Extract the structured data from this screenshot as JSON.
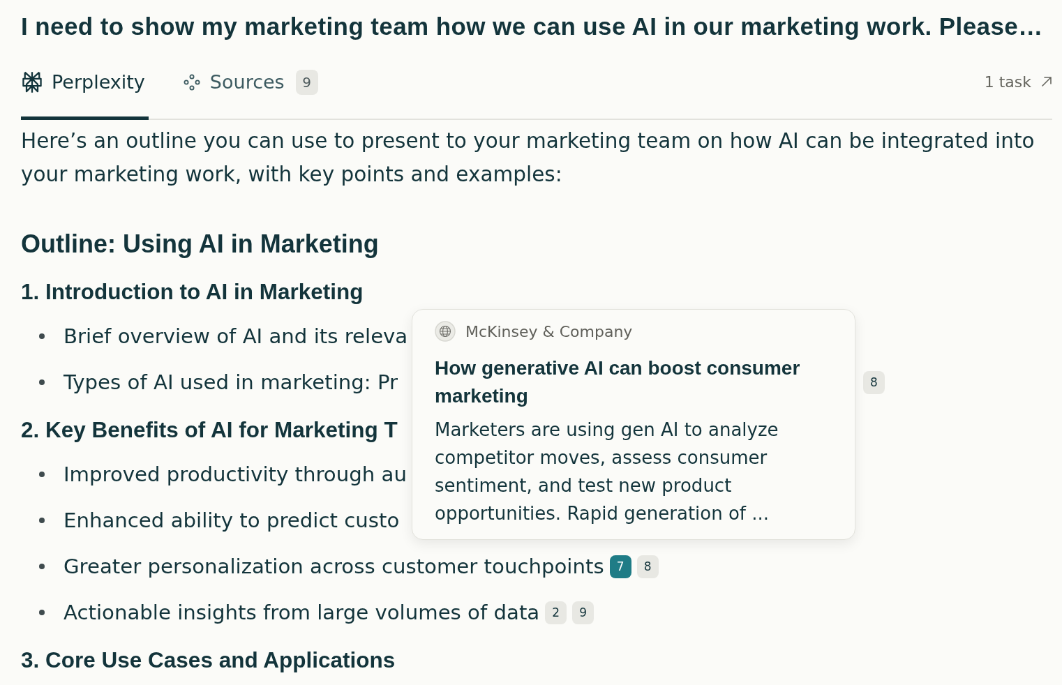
{
  "title": "I need to show my marketing team how we can use AI in our marketing work. Please…",
  "tabs": [
    {
      "label": "Perplexity",
      "selected": true
    },
    {
      "label": "Sources",
      "selected": false,
      "count": "9"
    }
  ],
  "tasks_link": {
    "label": "1 task"
  },
  "answer": {
    "intro": "Here’s an outline you can use to present to your marketing team on how AI can be integrated into your marketing work, with key points and examples:",
    "heading": "Outline: Using AI in Marketing",
    "sections": [
      {
        "heading": "1. Introduction to AI in Marketing",
        "bullets": [
          {
            "text": "Brief overview of AI and its releva",
            "kind": "covered"
          },
          {
            "text": "Types of AI used in marketing: Pr",
            "kind": "covered",
            "citations": [
              {
                "label": "8",
                "selected": false
              }
            ]
          }
        ]
      },
      {
        "heading": "2. Key Benefits of AI for Marketing T",
        "bullets": [
          {
            "text": "Improved productivity through au",
            "kind": "covered"
          },
          {
            "text": "Enhanced ability to predict custo",
            "kind": "covered"
          },
          {
            "text": "Greater personalization across customer touchpoints",
            "kind": "plain",
            "citations": [
              {
                "label": "7",
                "selected": true
              },
              {
                "label": "8",
                "selected": false
              }
            ]
          },
          {
            "text": "Actionable insights from large volumes of data",
            "kind": "plain",
            "citations": [
              {
                "label": "2",
                "selected": false
              },
              {
                "label": "9",
                "selected": false
              }
            ]
          }
        ]
      },
      {
        "heading": "3. Core Use Cases and Applications"
      }
    ]
  },
  "source_popover": {
    "site": "McKinsey & Company",
    "title": "How generative AI can boost consumer marketing",
    "snippet": "Marketers are using gen AI to analyze competitor moves, assess consumer sentiment, and test new product opportunities. Rapid generation of ..."
  }
}
